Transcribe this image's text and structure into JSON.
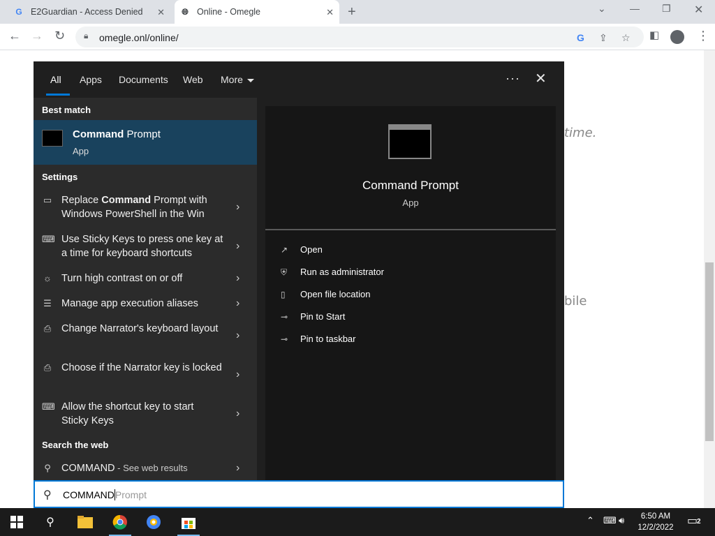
{
  "browser": {
    "tabs": [
      {
        "title": "E2Guardian - Access Denied",
        "favicon": "G"
      },
      {
        "title": "Online - Omegle",
        "favicon": "globe"
      }
    ],
    "url": "omegle.onl/online/"
  },
  "page_bg": {
    "text1": "time.",
    "text2": "bile"
  },
  "search": {
    "filters": [
      "All",
      "Apps",
      "Documents",
      "Web",
      "More"
    ],
    "active_filter": "All",
    "best_match_heading": "Best match",
    "best_match": {
      "title_bold": "Command",
      "title_rest": " Prompt",
      "subtitle": "App"
    },
    "settings_heading": "Settings",
    "settings_items": [
      {
        "pre": "Replace ",
        "bold": "Command",
        "post": " Prompt with Windows PowerShell in the Win",
        "icon": "monitor-icon"
      },
      {
        "pre": "Use Sticky Keys to press one key at a time for keyboard shortcuts",
        "bold": "",
        "post": "",
        "icon": "keyboard-icon"
      },
      {
        "pre": "Turn high contrast on or off",
        "bold": "",
        "post": "",
        "icon": "brightness-icon"
      },
      {
        "pre": "Manage app execution aliases",
        "bold": "",
        "post": "",
        "icon": "list-icon"
      },
      {
        "pre": "Change Narrator's keyboard layout",
        "bold": "",
        "post": "",
        "icon": "narrator-icon"
      },
      {
        "pre": "Choose if the Narrator key is locked",
        "bold": "",
        "post": "",
        "icon": "narrator-icon"
      },
      {
        "pre": "Allow the shortcut key to start Sticky Keys",
        "bold": "",
        "post": "",
        "icon": "keyboard-icon"
      }
    ],
    "web_heading": "Search the web",
    "web_item": {
      "query": "COMMAND",
      "suffix": " - See web results"
    },
    "preview": {
      "title": "Command Prompt",
      "subtitle": "App"
    },
    "actions": [
      {
        "label": "Open",
        "icon": "open-icon"
      },
      {
        "label": "Run as administrator",
        "icon": "admin-icon"
      },
      {
        "label": "Open file location",
        "icon": "file-location-icon"
      },
      {
        "label": "Pin to Start",
        "icon": "pin-icon"
      },
      {
        "label": "Pin to taskbar",
        "icon": "pin-icon"
      }
    ],
    "query": "COMMAND",
    "ghost": "Prompt"
  },
  "taskbar": {
    "time": "6:50 AM",
    "date": "12/2/2022",
    "notification_count": "2"
  },
  "colors": {
    "accent": "#0078d7",
    "selected_bg": "#19425d"
  }
}
